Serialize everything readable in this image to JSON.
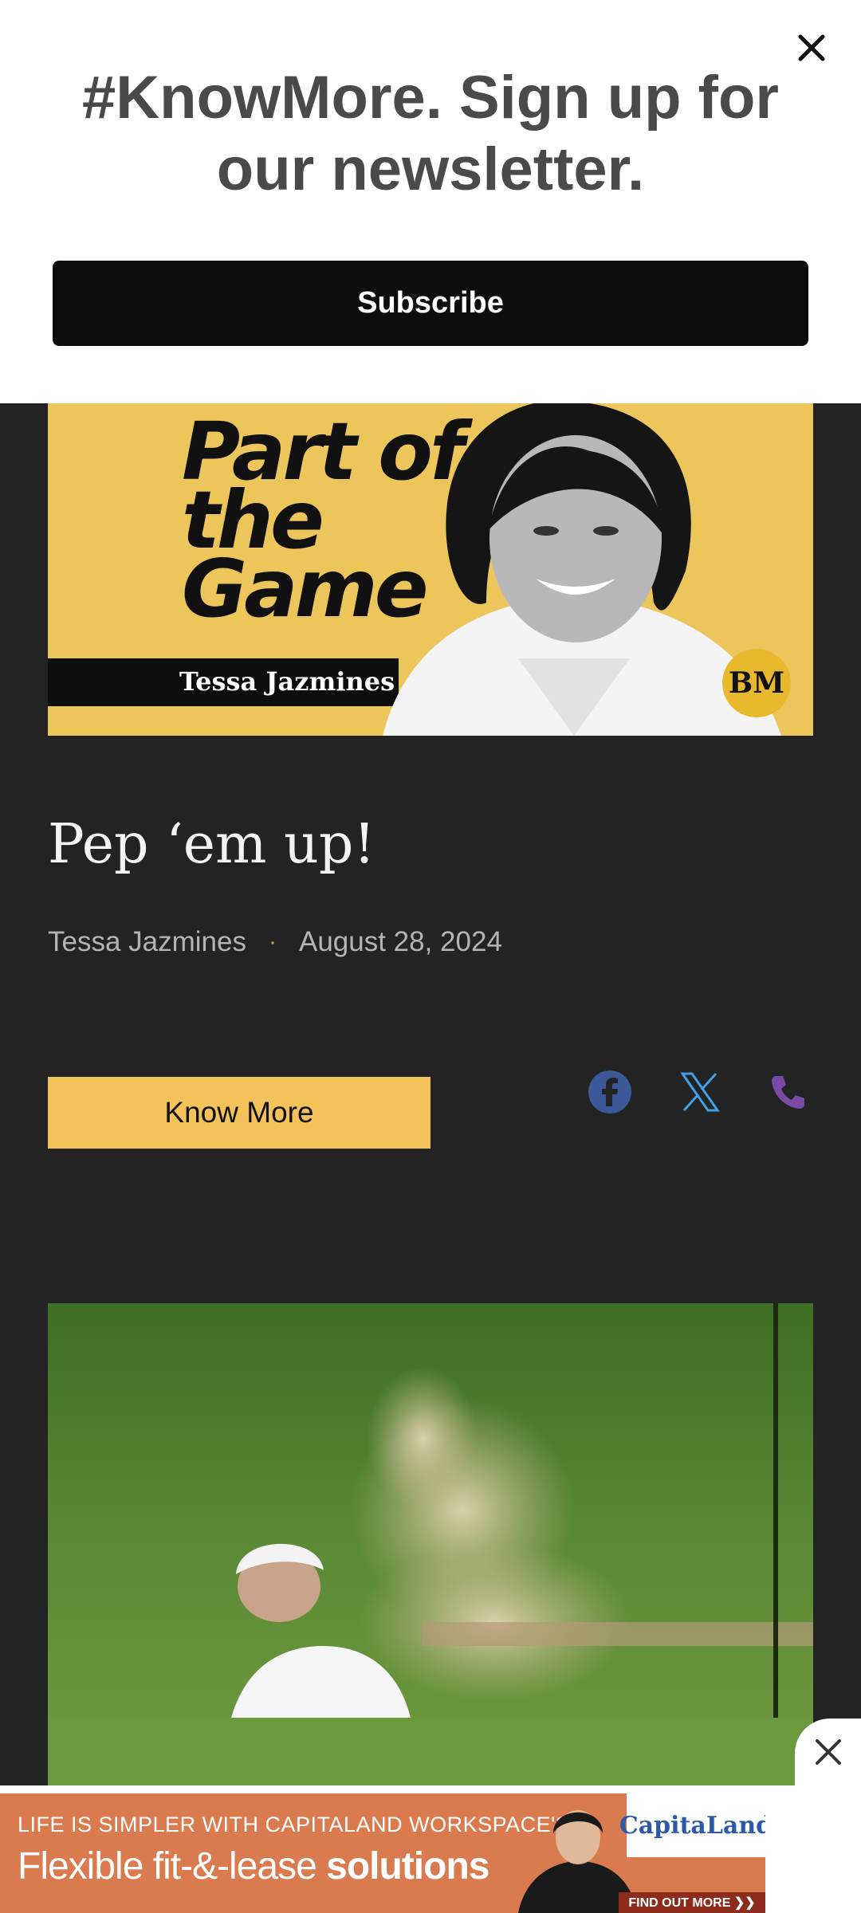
{
  "popup": {
    "title": "#KnowMore. Sign up for our newsletter.",
    "subscribe_label": "Subscribe",
    "close_icon": "close-icon"
  },
  "hero": {
    "series_title": "Part of the Game",
    "author_tag": "Tessa Jazmines",
    "badge": "BM",
    "accent_color": "#ecc55b"
  },
  "article": {
    "title": "Pep ‘em up!",
    "author": "Tessa Jazmines",
    "separator": "·",
    "date": "August 28, 2024",
    "know_more_label": "Know More"
  },
  "share": {
    "facebook_color": "#3b5998",
    "x_color": "#3fa0e8",
    "phone_color": "#7b4aa6"
  },
  "ad": {
    "line1": "LIFE IS SIMPLER WITH CAPITALAND WORKSPACE'S",
    "line2_plain": "Flexible fit-&-lease ",
    "line2_bold": "solutions",
    "brand": "CapitaLand",
    "cta": "FIND OUT MORE ❯❯"
  }
}
